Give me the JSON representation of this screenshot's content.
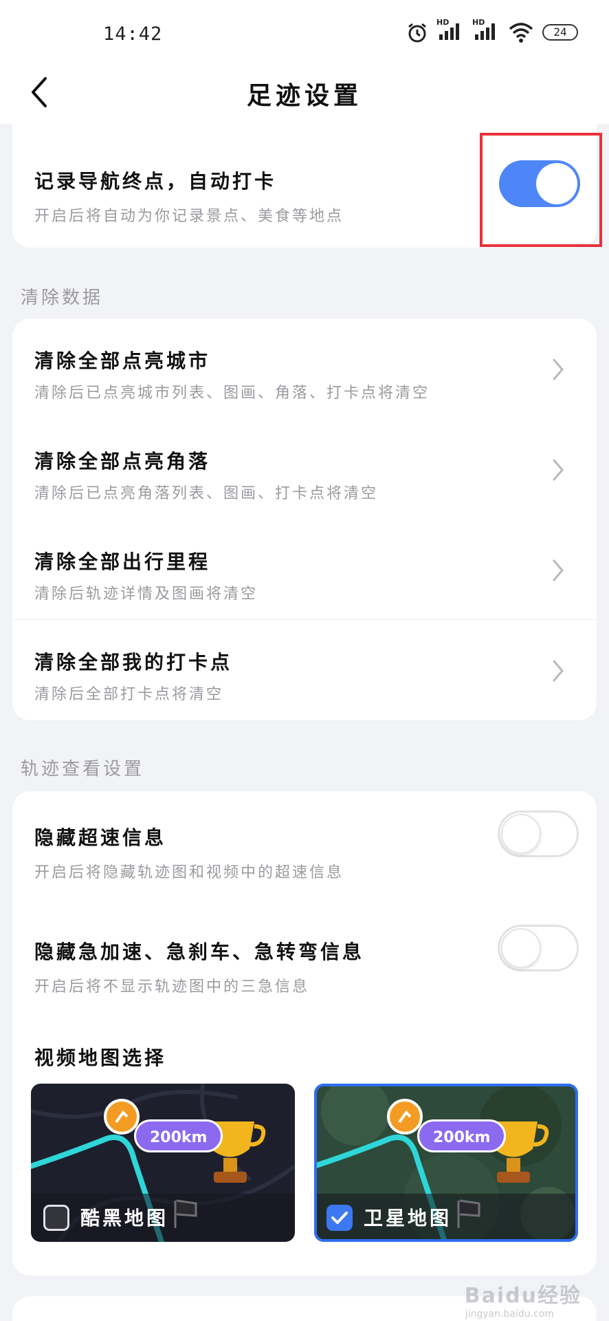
{
  "status_bar": {
    "time": "14:42",
    "battery": "24",
    "network_label": "HD",
    "icons": [
      "alarm-icon",
      "signal-icon",
      "signal-icon",
      "wifi-icon",
      "battery-icon"
    ]
  },
  "header": {
    "title": "足迹设置",
    "back_icon": "chevron-left-icon"
  },
  "auto_checkin": {
    "title": "记录导航终点，自动打卡",
    "subtitle": "开启后将自动为你记录景点、美食等地点",
    "enabled": true
  },
  "clear_section": {
    "label": "清除数据",
    "items": [
      {
        "title": "清除全部点亮城市",
        "subtitle": "清除后已点亮城市列表、图画、角落、打卡点将清空"
      },
      {
        "title": "清除全部点亮角落",
        "subtitle": "清除后已点亮角落列表、图画、打卡点将清空"
      },
      {
        "title": "清除全部出行里程",
        "subtitle": "清除后轨迹详情及图画将清空"
      },
      {
        "title": "清除全部我的打卡点",
        "subtitle": "清除后全部打卡点将清空"
      }
    ]
  },
  "track_section": {
    "label": "轨迹查看设置",
    "toggles": [
      {
        "title": "隐藏超速信息",
        "subtitle": "开启后将隐藏轨迹图和视频中的超速信息",
        "enabled": false
      },
      {
        "title": "隐藏急加速、急刹车、急转弯信息",
        "subtitle": "开启后将不显示轨迹图中的三急信息",
        "enabled": false
      }
    ],
    "video_map": {
      "title": "视频地图选择",
      "options": [
        {
          "label": "酷黑地图",
          "distance": "200km",
          "selected": false
        },
        {
          "label": "卫星地图",
          "distance": "200km",
          "selected": true
        }
      ]
    }
  },
  "colors": {
    "accent": "#4e86f7",
    "highlight_box": "#e8323c",
    "background": "#f2f3f7",
    "subtitle": "#9a9aa0"
  },
  "watermark": {
    "text": "Baidu经验",
    "sub": "jingyan.baidu.com"
  }
}
